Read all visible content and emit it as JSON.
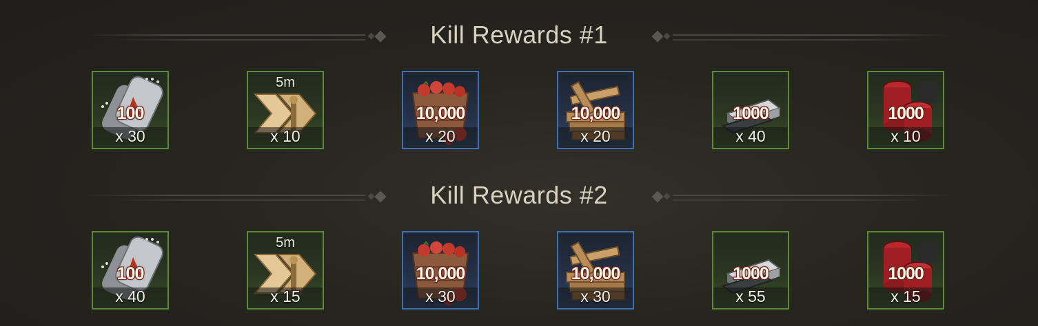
{
  "sections": [
    {
      "title": "Kill Rewards #1",
      "items": [
        {
          "icon": "dog-tag-icon",
          "amount": "100",
          "qty": "x 30",
          "timer": "",
          "rarity": "green"
        },
        {
          "icon": "speedup-chevron-icon",
          "amount": "",
          "qty": "x 10",
          "timer": "5m",
          "rarity": "green"
        },
        {
          "icon": "food-crate-icon",
          "amount": "10,000",
          "qty": "x 20",
          "timer": "",
          "rarity": "blue"
        },
        {
          "icon": "wood-planks-icon",
          "amount": "10,000",
          "qty": "x 20",
          "timer": "",
          "rarity": "blue"
        },
        {
          "icon": "steel-ingot-icon",
          "amount": "1000",
          "qty": "x 40",
          "timer": "",
          "rarity": "green"
        },
        {
          "icon": "red-chips-icon",
          "amount": "1000",
          "qty": "x 10",
          "timer": "",
          "rarity": "green"
        }
      ]
    },
    {
      "title": "Kill Rewards #2",
      "items": [
        {
          "icon": "dog-tag-icon",
          "amount": "100",
          "qty": "x 40",
          "timer": "",
          "rarity": "green"
        },
        {
          "icon": "speedup-chevron-icon",
          "amount": "",
          "qty": "x 15",
          "timer": "5m",
          "rarity": "green"
        },
        {
          "icon": "food-crate-icon",
          "amount": "10,000",
          "qty": "x 30",
          "timer": "",
          "rarity": "blue"
        },
        {
          "icon": "wood-planks-icon",
          "amount": "10,000",
          "qty": "x 30",
          "timer": "",
          "rarity": "blue"
        },
        {
          "icon": "steel-ingot-icon",
          "amount": "1000",
          "qty": "x 55",
          "timer": "",
          "rarity": "green"
        },
        {
          "icon": "red-chips-icon",
          "amount": "1000",
          "qty": "x 15",
          "timer": "",
          "rarity": "green"
        }
      ]
    }
  ],
  "colors": {
    "green_border": "#5d8a34",
    "blue_border": "#3f70b3",
    "title_text": "#d9d2c2",
    "background": "#27251f"
  }
}
